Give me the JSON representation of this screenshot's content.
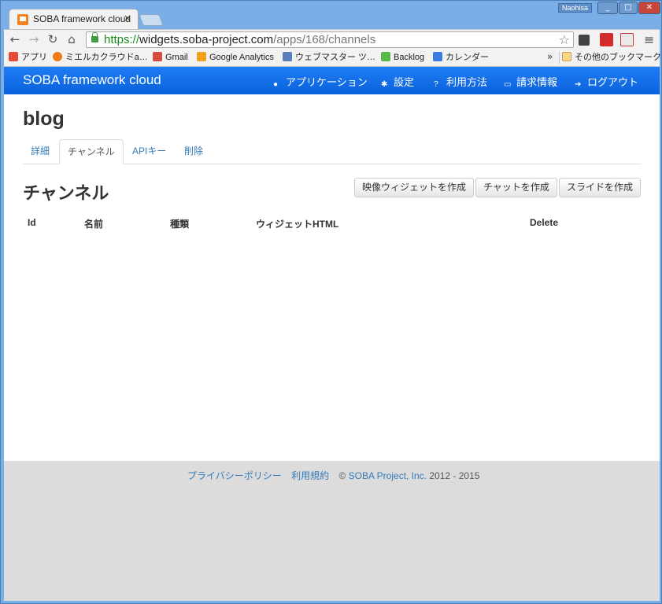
{
  "browser": {
    "tab_title": "SOBA framework cloud",
    "tab_close": "×",
    "user_badge": "Naohisa",
    "url_scheme": "https://",
    "url_host": "widgets.soba-project.com",
    "url_path": "/apps/168/channels",
    "bookmarks": [
      {
        "label": "アプリ",
        "icon": "apps-grid-icon",
        "color": "#e84a3a"
      },
      {
        "label": "ミエルカクラウドa…",
        "icon": "mieruca-icon",
        "color": "#f07a1a"
      },
      {
        "label": "Gmail",
        "icon": "gmail-icon",
        "color": "#d54b3d"
      },
      {
        "label": "Google Analytics",
        "icon": "analytics-icon",
        "color": "#f3a01b"
      },
      {
        "label": "ウェブマスター ツ…",
        "icon": "webmaster-icon",
        "color": "#5b7fb8"
      },
      {
        "label": "Backlog",
        "icon": "backlog-icon",
        "color": "#56b848"
      },
      {
        "label": "カレンダー",
        "icon": "calendar-icon",
        "color": "#3a7de0"
      }
    ],
    "bookmarks_more": "»",
    "other_bookmarks": "その他のブックマーク"
  },
  "navbar": {
    "brand": "SOBA framework cloud",
    "links": [
      {
        "label": "アプリケーション",
        "icon": "globe-icon"
      },
      {
        "label": "設定",
        "icon": "gear-icon"
      },
      {
        "label": "利用方法",
        "icon": "question-icon"
      },
      {
        "label": "請求情報",
        "icon": "credit-card-icon"
      },
      {
        "label": "ログアウト",
        "icon": "logout-icon"
      }
    ]
  },
  "page": {
    "title": "blog",
    "tabs": [
      "詳細",
      "チャンネル",
      "APIキー",
      "削除"
    ],
    "active_tab": "チャンネル",
    "section_title": "チャンネル",
    "buttons": [
      "映像ウィジェットを作成",
      "チャットを作成",
      "スライドを作成"
    ],
    "table_headers": [
      "Id",
      "名前",
      "種類",
      "ウィジェットHTML",
      "Delete"
    ]
  },
  "footer": {
    "privacy": "プライバシーポリシー",
    "terms": "利用規約",
    "copyright_prefix": "© ",
    "company": "SOBA Project, Inc.",
    "years": " 2012 - 2015"
  },
  "colors": {
    "navbar": "#1a73f0",
    "link": "#337ab7",
    "footer_bg": "#dcdcdc"
  }
}
